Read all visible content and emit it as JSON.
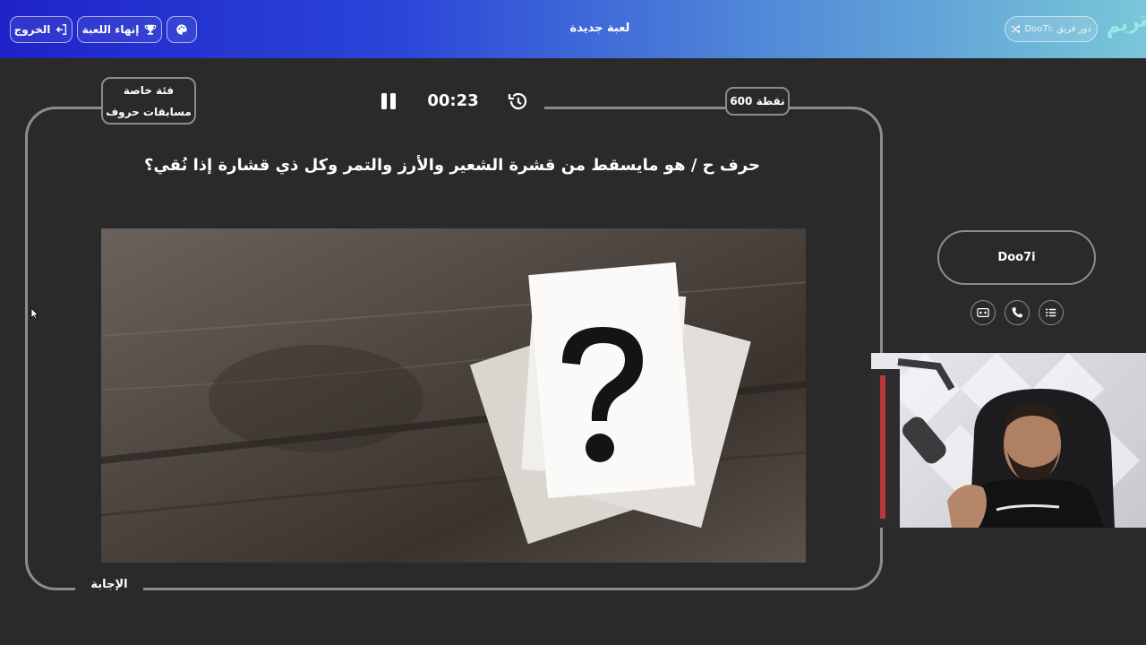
{
  "header": {
    "exit_label": "الخروج",
    "end_game_label": "إنهاء اللعبة",
    "title": "لعبة جديدة",
    "team_label": "Doo7i: دور فريق",
    "logo_text": "تريم",
    "gradient_colors": [
      "#1f23c8",
      "#79c7d8"
    ]
  },
  "game": {
    "category_line1": "فئة خاصة",
    "category_line2": "مسابقات حروف",
    "timer": "00:23",
    "points": "600 نقطة",
    "question": "حرف ح / هو مايسقط من قشرة الشعير والأرز والتمر وكل ذي قشارة إذا نُقي؟",
    "answer_label": "الإجابة"
  },
  "player": {
    "name": "Doo7i"
  },
  "icons": {
    "exit": "exit-icon",
    "end_game": "trophy-icon",
    "palette": "palette-icon",
    "shuffle": "shuffle-icon",
    "pause": "pause-icon",
    "reset": "history-icon",
    "tool1": "image-swap-icon",
    "tool2": "phone-icon",
    "tool3": "list-icon"
  }
}
